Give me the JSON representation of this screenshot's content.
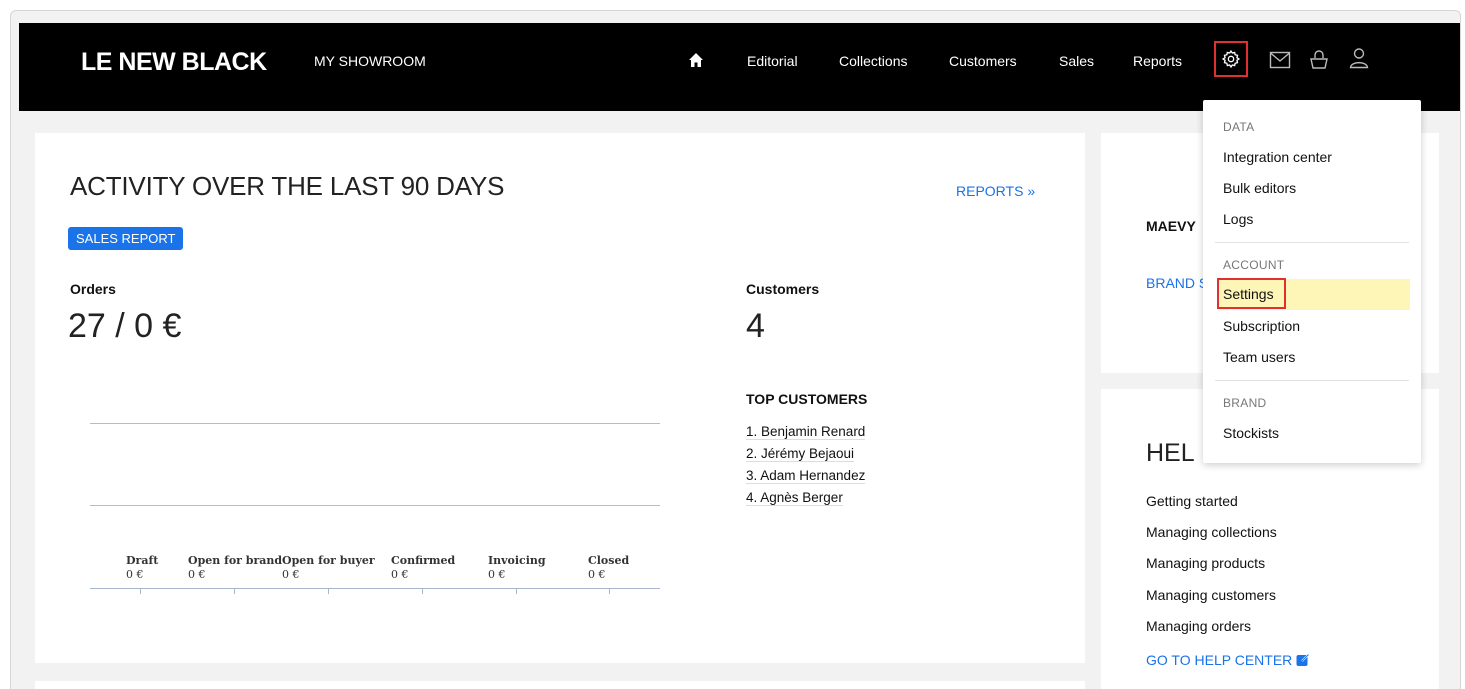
{
  "header": {
    "logo": "LE NEW BLACK",
    "showroom": "MY SHOWROOM",
    "nav": [
      "Editorial",
      "Collections",
      "Customers",
      "Sales",
      "Reports"
    ],
    "icons": [
      "home-icon",
      "gear-icon",
      "mail-icon",
      "bag-icon",
      "user-icon"
    ]
  },
  "activity": {
    "title": "ACTIVITY OVER THE LAST 90 DAYS",
    "reports_link": "REPORTS »",
    "badge": "SALES REPORT",
    "orders_label": "Orders",
    "orders_value": "27 / 0 €",
    "customers_label": "Customers",
    "customers_value": "4",
    "top_customers_label": "TOP CUSTOMERS",
    "top_customers": [
      "1. Benjamin Renard",
      "2. Jérémy Bejaoui",
      "3. Adam Hernandez",
      "4. Agnès Berger"
    ],
    "statuses": [
      {
        "label": "Draft",
        "value": "0 €"
      },
      {
        "label": "Open for brand",
        "value": "0 €"
      },
      {
        "label": "Open for buyer",
        "value": "0 €"
      },
      {
        "label": "Confirmed",
        "value": "0 €"
      },
      {
        "label": "Invoicing",
        "value": "0 €"
      },
      {
        "label": "Closed",
        "value": "0 €"
      }
    ]
  },
  "side": {
    "brand_name": "MAEVY",
    "brand_link": "BRAND S",
    "help_title": "HEL",
    "help_links": [
      "Getting started",
      "Managing collections",
      "Managing products",
      "Managing customers",
      "Managing orders"
    ],
    "help_center": "GO TO HELP CENTER"
  },
  "dropdown": {
    "data_label": "DATA",
    "data_items": [
      "Integration center",
      "Bulk editors",
      "Logs"
    ],
    "account_label": "ACCOUNT",
    "account_items": [
      "Settings",
      "Subscription",
      "Team users"
    ],
    "brand_label": "BRAND",
    "brand_items": [
      "Stockists"
    ]
  },
  "colors": {
    "accent": "#1a73e8",
    "highlight": "#fdf6b6",
    "outline": "#e23030"
  }
}
